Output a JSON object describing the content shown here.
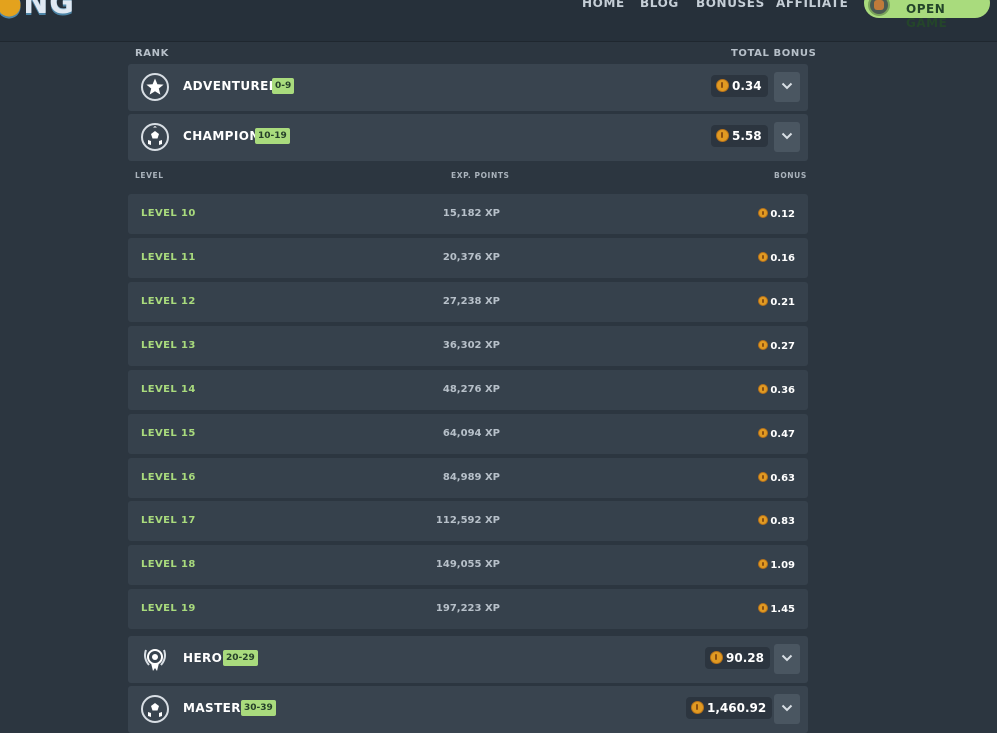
{
  "header": {
    "logo_text": "NG",
    "nav": [
      "HOME",
      "BLOG",
      "BONUSES",
      "AFFILIATE"
    ],
    "open_game_label": "OPEN GAME"
  },
  "table": {
    "rank_header": "RANK",
    "total_bonus_header": "TOTAL BONUS",
    "ranks": [
      {
        "name": "ADVENTURER",
        "range": "0-9",
        "bonus": "0.34",
        "icon": "star-badge-icon"
      },
      {
        "name": "CHAMPION",
        "range": "10-19",
        "bonus": "5.58",
        "icon": "soccer-ball-icon"
      },
      {
        "name": "HERO",
        "range": "20-29",
        "bonus": "90.28",
        "icon": "laurel-medal-icon"
      },
      {
        "name": "MASTER",
        "range": "30-39",
        "bonus": "1,460.92",
        "icon": "soccer-ball-icon"
      }
    ],
    "level_headers": {
      "level": "LEVEL",
      "exp": "EXP. POINTS",
      "bonus": "BONUS"
    },
    "levels": [
      {
        "level": "LEVEL 10",
        "xp": "15,182 XP",
        "bonus": "0.12"
      },
      {
        "level": "LEVEL 11",
        "xp": "20,376 XP",
        "bonus": "0.16"
      },
      {
        "level": "LEVEL 12",
        "xp": "27,238 XP",
        "bonus": "0.21"
      },
      {
        "level": "LEVEL 13",
        "xp": "36,302 XP",
        "bonus": "0.27"
      },
      {
        "level": "LEVEL 14",
        "xp": "48,276 XP",
        "bonus": "0.36"
      },
      {
        "level": "LEVEL 15",
        "xp": "64,094 XP",
        "bonus": "0.47"
      },
      {
        "level": "LEVEL 16",
        "xp": "84,989 XP",
        "bonus": "0.63"
      },
      {
        "level": "LEVEL 17",
        "xp": "112,592 XP",
        "bonus": "0.83"
      },
      {
        "level": "LEVEL 18",
        "xp": "149,055 XP",
        "bonus": "1.09"
      },
      {
        "level": "LEVEL 19",
        "xp": "197,223 XP",
        "bonus": "1.45"
      }
    ]
  },
  "colors": {
    "background": "#2c3640",
    "row": "#39444f",
    "accent_green": "#a9db7d",
    "coin": "#e19a22"
  }
}
